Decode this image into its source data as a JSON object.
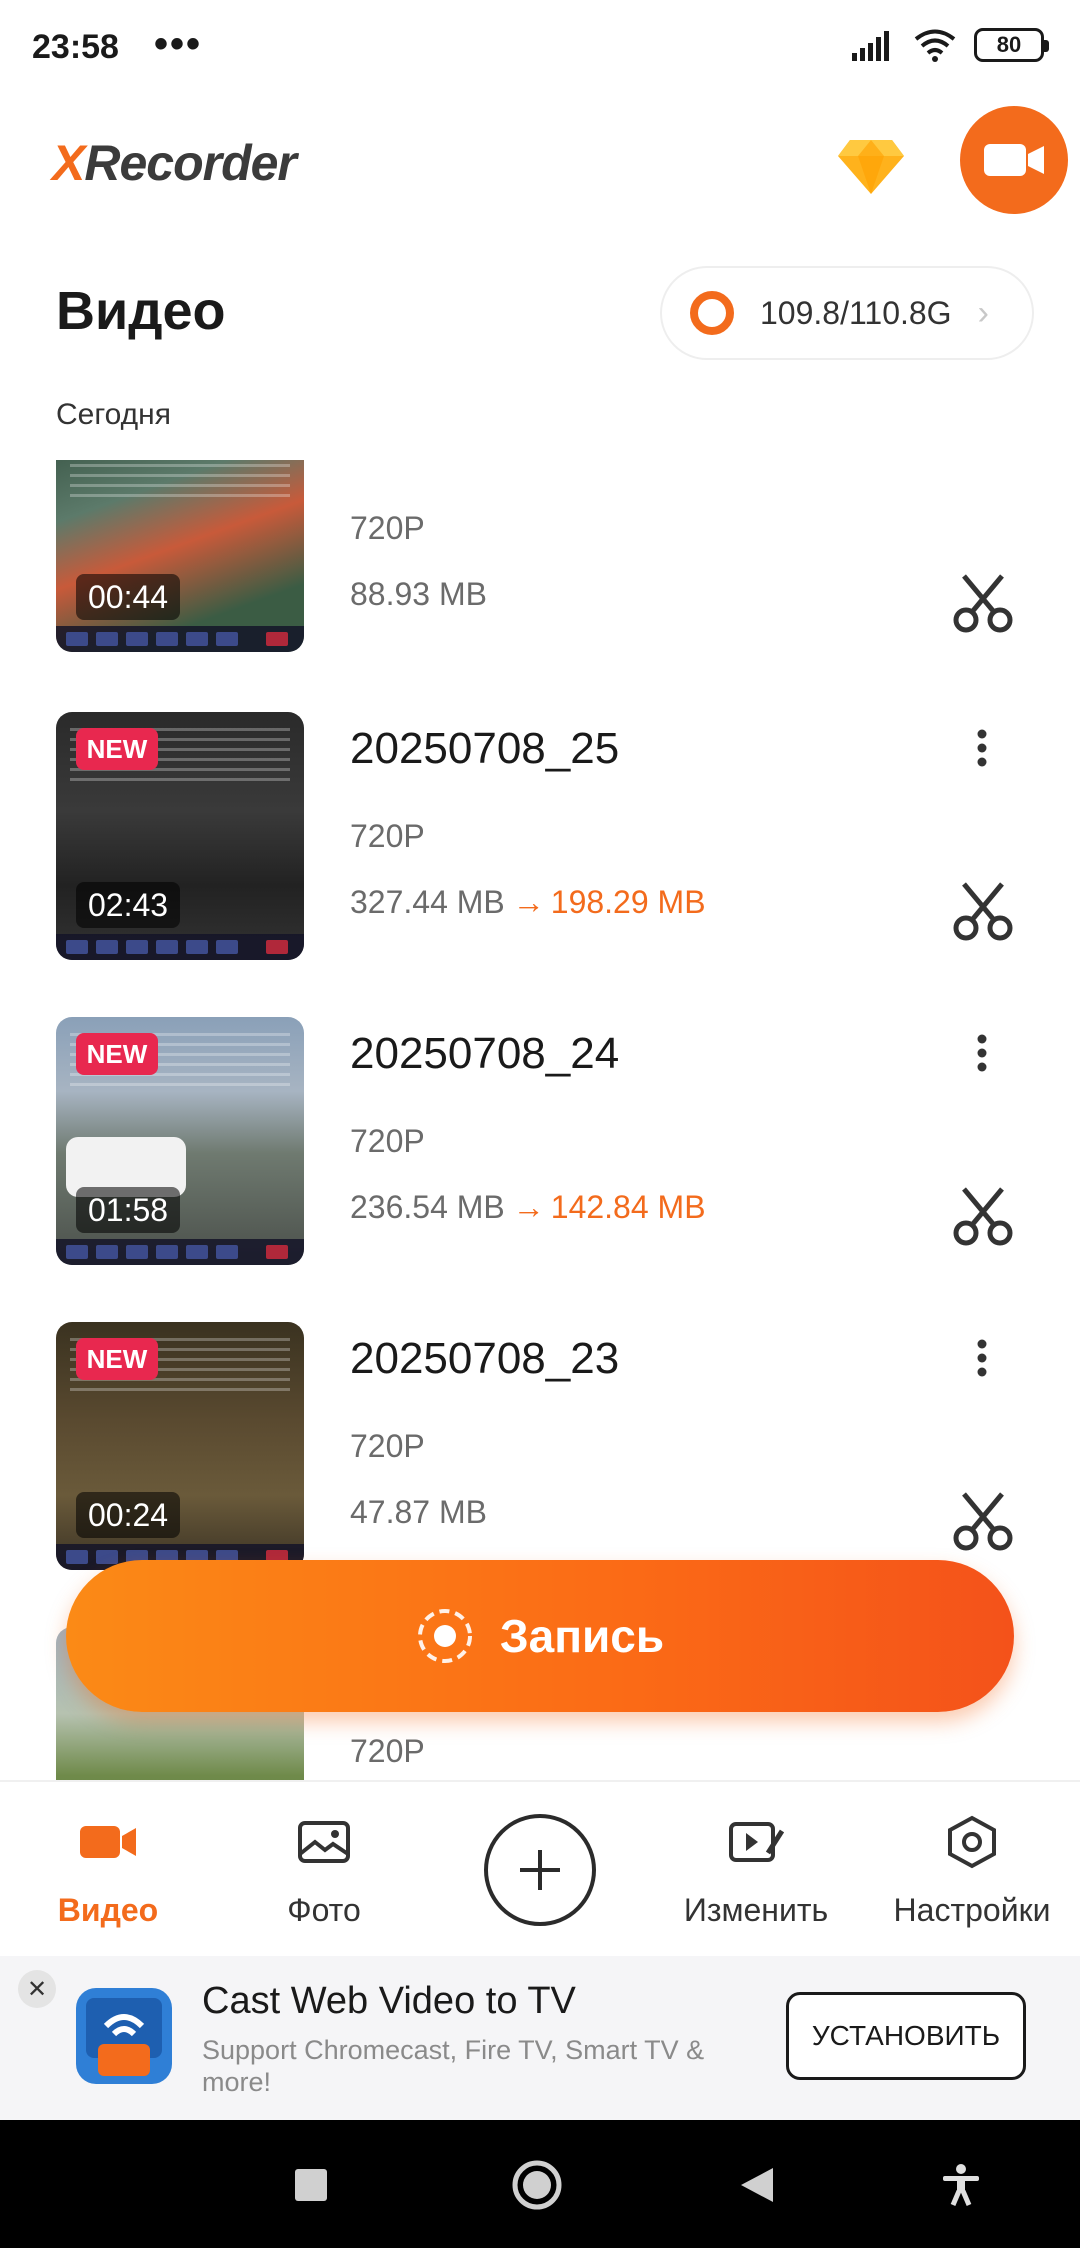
{
  "status_bar": {
    "time": "23:58",
    "dots": "•••",
    "battery": "80"
  },
  "header": {
    "logo_x": "X",
    "logo_rest": "Recorder",
    "premium_icon": "diamond-icon",
    "record_icon": "video-camera-icon"
  },
  "page": {
    "title": "Видео",
    "storage": "109.8/110.8G",
    "section": "Сегодня"
  },
  "videos": [
    {
      "title": "",
      "is_new": false,
      "duration": "00:44",
      "resolution": "720P",
      "size": "88.93 MB",
      "compressed": ""
    },
    {
      "title": "20250708_25",
      "is_new": true,
      "duration": "02:43",
      "resolution": "720P",
      "size": "327.44 MB",
      "compressed": "198.29 MB"
    },
    {
      "title": "20250708_24",
      "is_new": true,
      "duration": "01:58",
      "resolution": "720P",
      "size": "236.54 MB",
      "compressed": "142.84 MB"
    },
    {
      "title": "20250708_23",
      "is_new": true,
      "duration": "00:24",
      "resolution": "720P",
      "size": "47.87 MB",
      "compressed": ""
    },
    {
      "title": "",
      "is_new": false,
      "duration": "",
      "resolution": "720P",
      "size": "",
      "compressed": ""
    }
  ],
  "new_badge": "NEW",
  "arrow": "→",
  "record_button": {
    "label": "Запись"
  },
  "nav": {
    "video": "Видео",
    "photo": "Фото",
    "edit": "Изменить",
    "settings": "Настройки"
  },
  "ad": {
    "title": "Cast Web Video to TV",
    "description": "Support Chromecast, Fire TV, Smart TV & more!",
    "install": "УСТАНОВИТЬ",
    "close": "✕"
  },
  "colors": {
    "accent": "#f36b1c",
    "badge": "#e8284f"
  }
}
